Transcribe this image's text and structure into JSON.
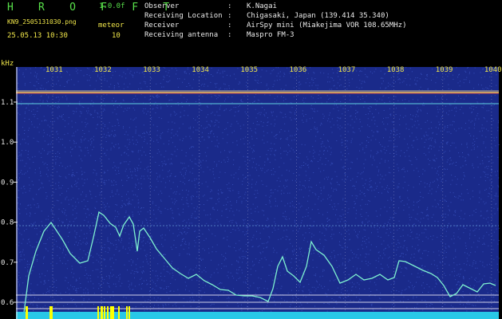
{
  "header": {
    "logo": "H R O F F T",
    "version": "1.0.0f",
    "filename": "KN9_2505131030.png",
    "meteor_label": "meteor",
    "timestamp": "25.05.13 10:30",
    "meteor_count": "10",
    "fields": [
      {
        "key": "Observer",
        "value": "K.Nagai"
      },
      {
        "key": "Receiving Location",
        "value": "Chigasaki, Japan (139.414 35.340)"
      },
      {
        "key": "Receiver",
        "value": "AirSpy mini (Miakejima VOR 108.65MHz)"
      },
      {
        "key": "Receiving antenna",
        "value": "Maspro FM-3"
      }
    ]
  },
  "spectrogram": {
    "y_unit": "kHz",
    "y_ticks": [
      "1.1",
      "1.0",
      "0.9",
      "0.8",
      "0.7",
      "0.6"
    ],
    "x_ticks": [
      "1031",
      "1032",
      "1033",
      "1034",
      "1035",
      "1036",
      "1037",
      "1038",
      "1039",
      "1040"
    ],
    "colors": {
      "background": "#1a2a8a",
      "noise": "#4a6ae0",
      "trace": "#7ef0d0",
      "carrier": "#e0e0e0",
      "bottom_band": "#28c8e8",
      "meteor_marks": "#ffff00"
    }
  }
}
